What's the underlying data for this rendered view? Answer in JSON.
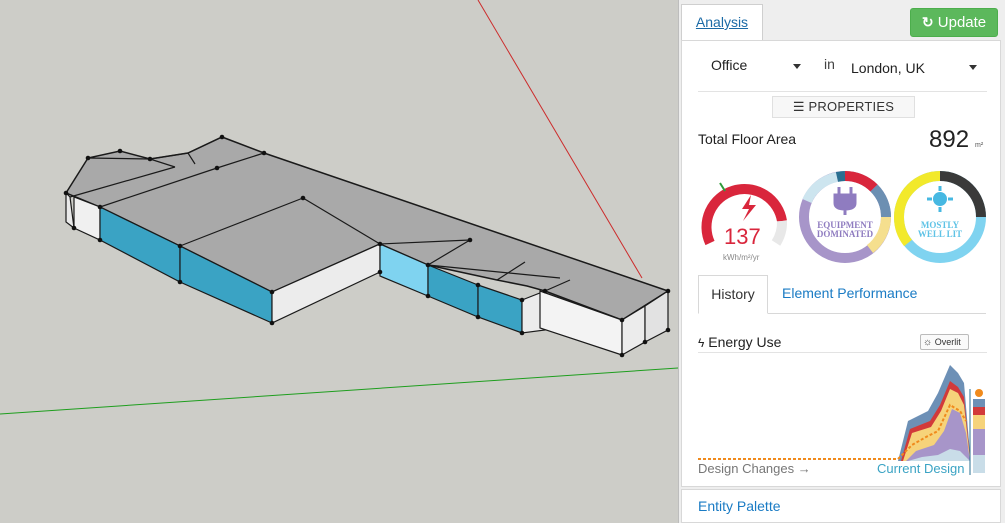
{
  "viewport": {
    "axis_colors": {
      "red_axis": "#cc2b2b",
      "green_axis": "#1e9e1e"
    },
    "glass_color": "#3aa3c4",
    "roof_color": "#a8a8a8",
    "wall_color": "#ececec"
  },
  "panel": {
    "tab_analysis": "Analysis",
    "update_label": "Update",
    "building_type": "Office",
    "in_label": "in",
    "location": "London, UK",
    "properties_label": "PROPERTIES",
    "floor_area_label": "Total Floor Area",
    "floor_area_value": "892",
    "floor_area_unit": "m²",
    "energy_value": "137",
    "energy_unit": "kWh/m²/yr",
    "equipment_line1": "EQUIPMENT",
    "equipment_line2": "DOMINATED",
    "light_line1": "MOSTLY",
    "light_line2": "WELL LIT",
    "tab_history": "History",
    "tab_element": "Element Performance",
    "energy_use_label": "Energy Use",
    "overlit_label": "Overlit",
    "design_changes_label": "Design Changes →",
    "current_design_label": "Current Design",
    "entity_palette": "Entity Palette",
    "colors": {
      "accent_link": "#1a7bc4",
      "update_green": "#5cb85c",
      "energy_red": "#d9263c",
      "equipment_purple": "#a795c9",
      "light_yellow": "#f2e92b",
      "light_blue": "#7fd3f0",
      "history_orange": "#f08a1c"
    }
  }
}
